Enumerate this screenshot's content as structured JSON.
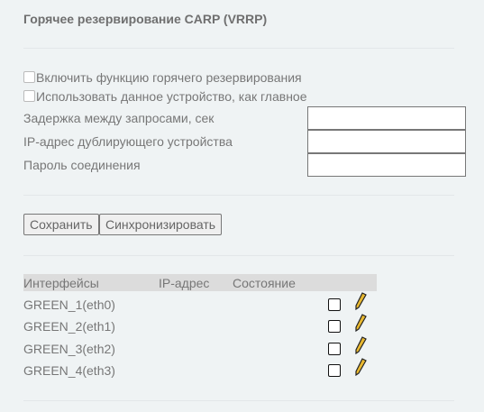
{
  "title": "Горячее резервирование CARP (VRRP)",
  "options": {
    "enable": "Включить функцию горячего резервирования",
    "master": "Использовать данное устройство, как главное"
  },
  "fields": [
    {
      "label": "Задержка между запросами, сек",
      "value": ""
    },
    {
      "label": "IP-адрес дублирующего устройства",
      "value": ""
    },
    {
      "label": "Пароль соединения",
      "value": ""
    }
  ],
  "buttons": {
    "save": "Сохранить",
    "sync": "Синхронизировать"
  },
  "table": {
    "headers": [
      "Интерфейсы",
      "IP-адрес",
      "Состояние"
    ],
    "rows": [
      {
        "iface": "GREEN_1(eth0)",
        "ip": "",
        "state": ""
      },
      {
        "iface": "GREEN_2(eth1)",
        "ip": "",
        "state": ""
      },
      {
        "iface": "GREEN_3(eth2)",
        "ip": "",
        "state": ""
      },
      {
        "iface": "GREEN_4(eth3)",
        "ip": "",
        "state": ""
      }
    ]
  },
  "colors": {
    "pencil": "#e8b830"
  }
}
